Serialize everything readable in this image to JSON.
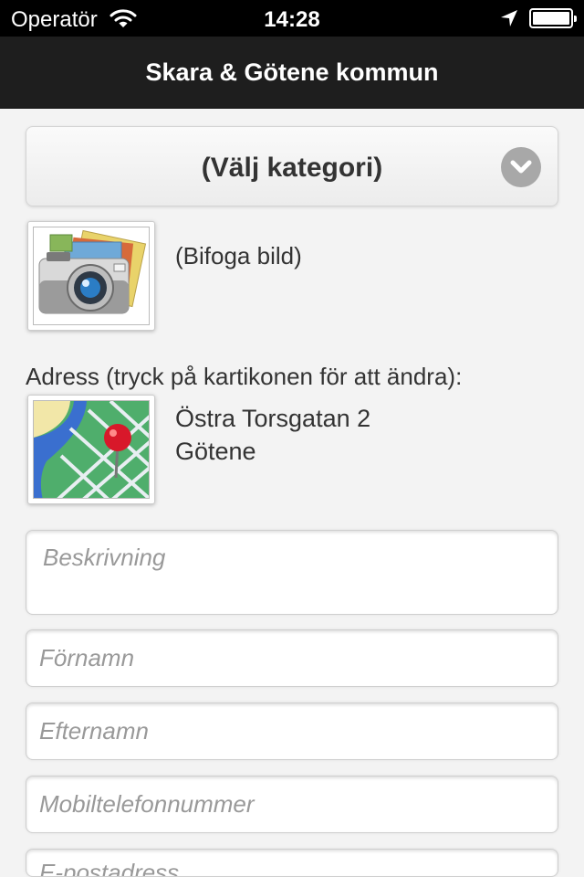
{
  "status_bar": {
    "carrier": "Operatör",
    "time": "14:28"
  },
  "nav": {
    "title": "Skara & Götene kommun"
  },
  "category_picker": {
    "selected": "(Välj kategori)"
  },
  "photo": {
    "label": "(Bifoga bild)"
  },
  "address": {
    "heading": "Adress (tryck på kartikonen för att ändra):",
    "street": "Östra Torsgatan 2",
    "city": "Götene"
  },
  "form": {
    "description_placeholder": "Beskrivning",
    "first_name_placeholder": "Förnamn",
    "last_name_placeholder": "Efternamn",
    "mobile_placeholder": "Mobiltelefonnummer",
    "email_placeholder": "E-postadress"
  },
  "colors": {
    "navbar": "#1e1e1e",
    "background": "#f3f3f3",
    "chevron": "#a8a8a8",
    "map_pin": "#d8182a"
  }
}
